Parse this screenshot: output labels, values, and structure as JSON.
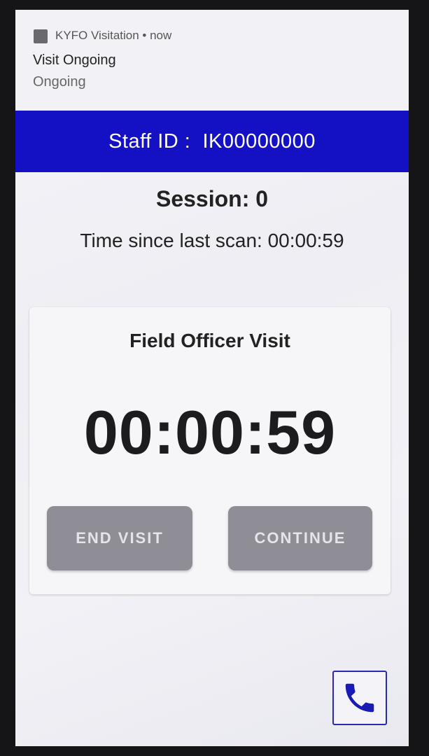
{
  "notification": {
    "app_name": "KYFO Visitation",
    "time": "now",
    "header": "KYFO Visitation • now",
    "title": "Visit Ongoing",
    "text": "Ongoing"
  },
  "staff": {
    "label": "Staff ID :  IK00000000"
  },
  "session": {
    "label": "Session: 0"
  },
  "last_scan": {
    "label": "Time since last scan: 00:00:59"
  },
  "visit_card": {
    "title": "Field Officer Visit",
    "timer": "00:00:59",
    "end_label": "END VISIT",
    "continue_label": "CONTINUE"
  },
  "call_button": {
    "icon": "phone-icon"
  },
  "colors": {
    "accent": "#1410c4",
    "button_bg": "#8f8e96",
    "button_text": "#e4e4ea",
    "call_icon": "#1a1ab4"
  }
}
